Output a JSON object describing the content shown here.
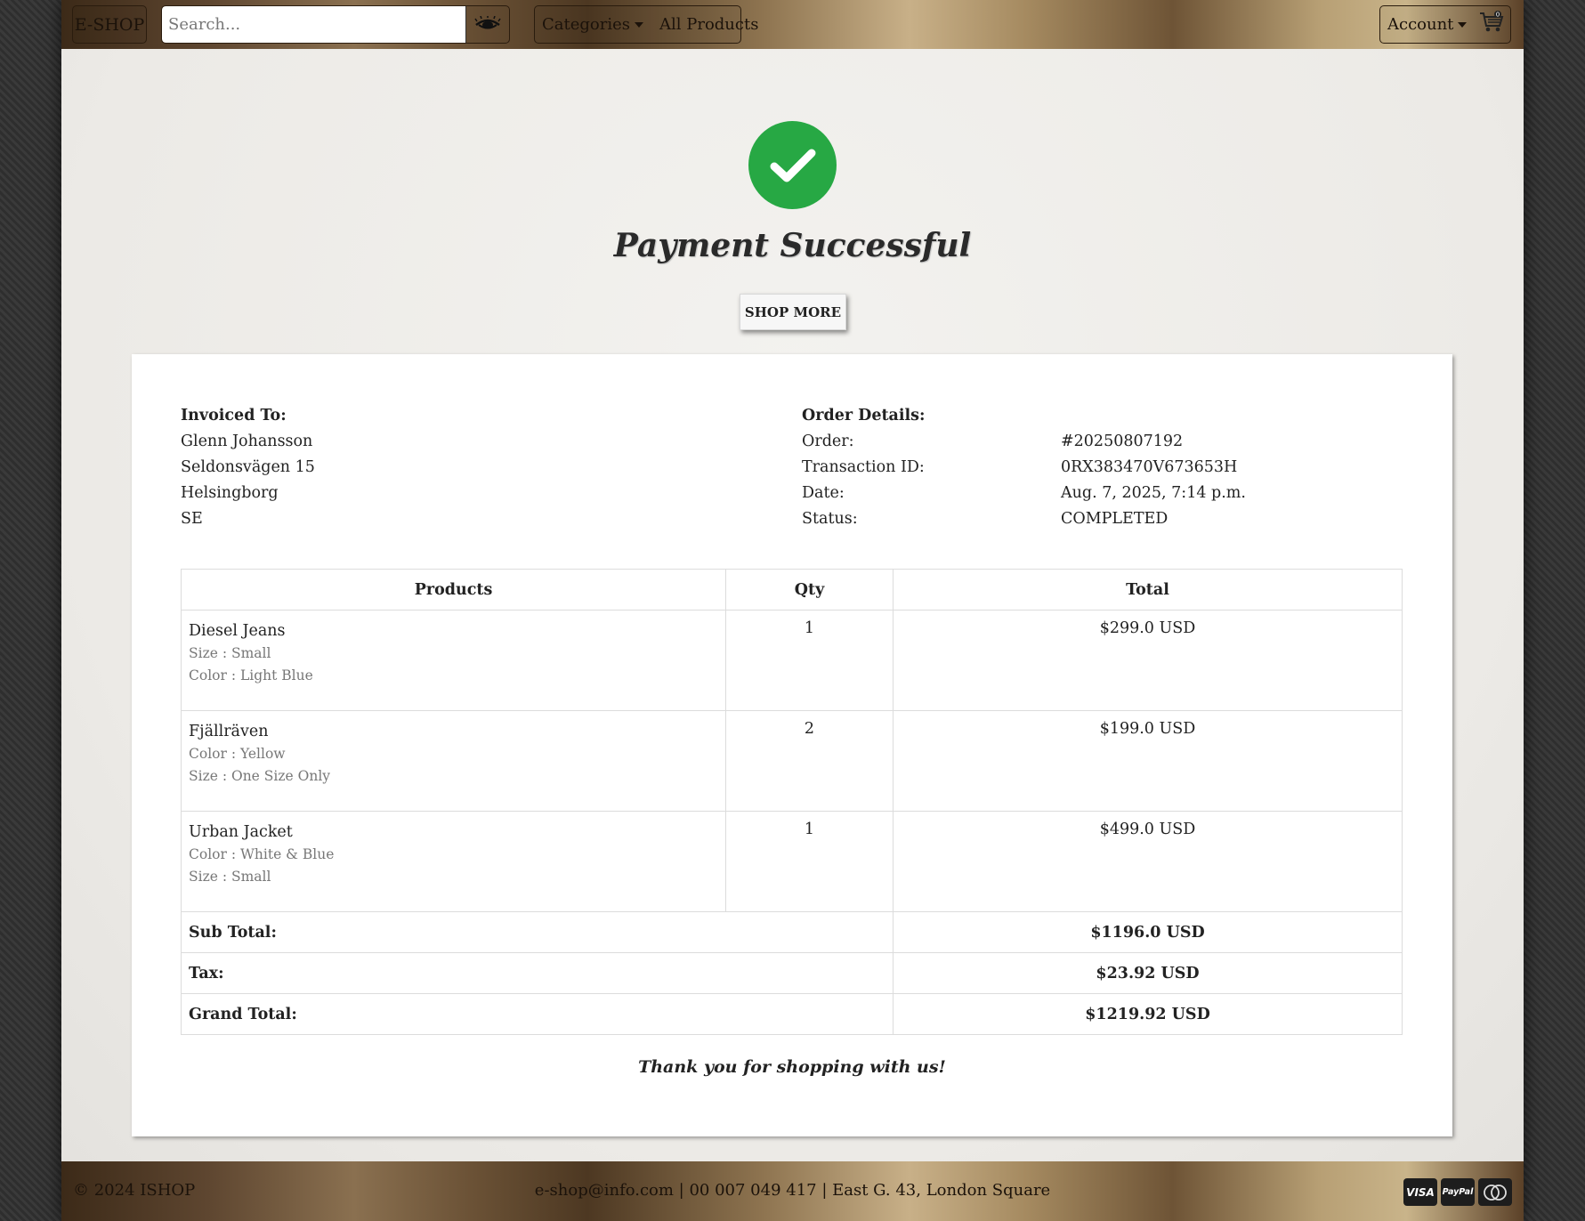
{
  "navbar": {
    "brand": "E-SHOP",
    "search_placeholder": "Search...",
    "search_icon": "eye-search-icon",
    "categories_label": "Categories",
    "all_products_label": "All Products",
    "account_label": "Account",
    "cart_icon": "cart-icon"
  },
  "hero": {
    "status_icon": "check-circle-icon",
    "title": "Payment Successful",
    "shop_more_label": "SHOP MORE"
  },
  "invoice": {
    "invoiced_to": {
      "heading": "Invoiced To:",
      "name": "Glenn Johansson",
      "street": "Seldonsvägen 15",
      "city": "Helsingborg",
      "country": "SE"
    },
    "order_details": {
      "heading": "Order Details:",
      "rows": [
        {
          "label": "Order:",
          "value": "#20250807192"
        },
        {
          "label": "Transaction ID:",
          "value": "0RX383470V673653H"
        },
        {
          "label": "Date:",
          "value": "Aug. 7, 2025, 7:14 p.m."
        },
        {
          "label": "Status:",
          "value": "COMPLETED"
        }
      ]
    },
    "table": {
      "headers": [
        "Products",
        "Qty",
        "Total"
      ],
      "rows": [
        {
          "name": "Diesel Jeans",
          "attrs": [
            "Size : Small",
            "Color : Light Blue"
          ],
          "qty": "1",
          "total": "$299.0 USD"
        },
        {
          "name": "Fjällräven",
          "attrs": [
            "Color : Yellow",
            "Size : One Size Only"
          ],
          "qty": "2",
          "total": "$199.0 USD"
        },
        {
          "name": "Urban Jacket",
          "attrs": [
            "Color : White & Blue",
            "Size : Small"
          ],
          "qty": "1",
          "total": "$499.0 USD"
        }
      ],
      "summary": [
        {
          "label": "Sub Total:",
          "value": "$1196.0 USD"
        },
        {
          "label": "Tax:",
          "value": "$23.92 USD"
        },
        {
          "label": "Grand Total:",
          "value": "$1219.92 USD"
        }
      ]
    },
    "thanks": "Thank you for shopping with us!"
  },
  "footer": {
    "copyright": "© 2024 ISHOP",
    "contact": "e-shop@info.com | 00 007 049 417 | East G. 43, London Square",
    "payment_methods": [
      "VISA",
      "PayPal",
      "mastercard"
    ]
  },
  "colors": {
    "success": "#27a844",
    "gold": "#c8b088"
  }
}
